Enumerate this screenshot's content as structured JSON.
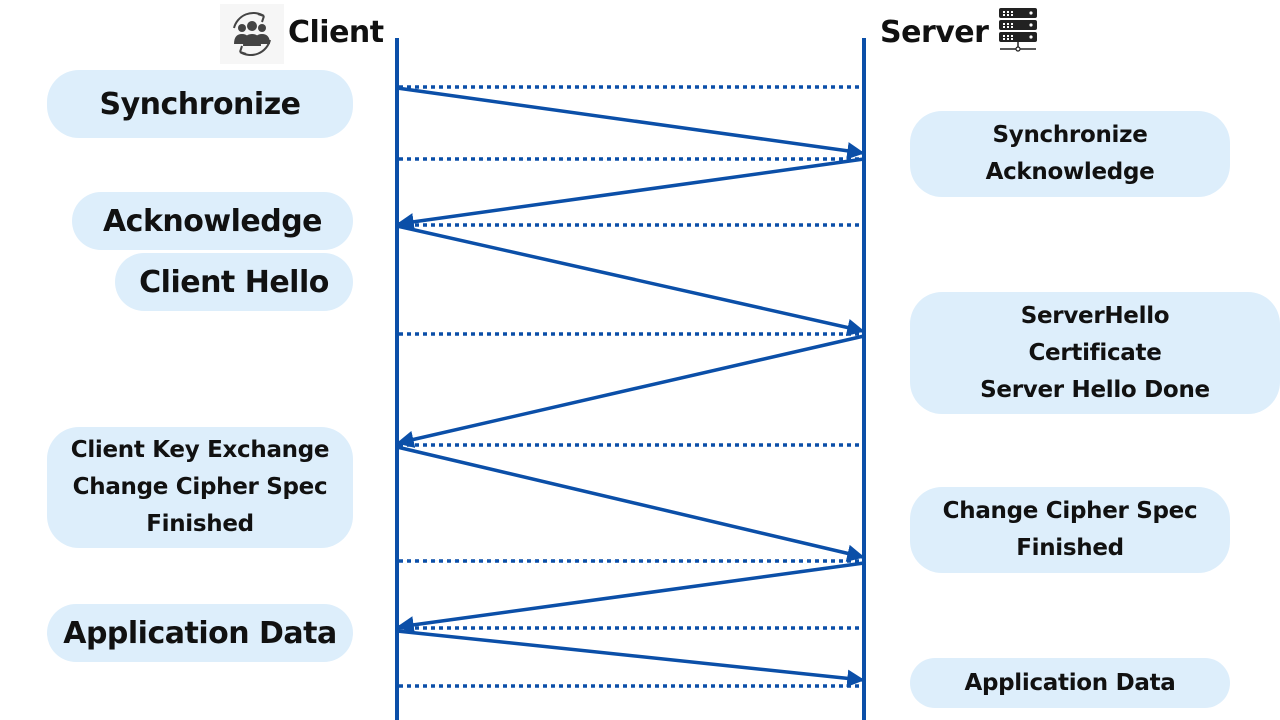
{
  "participants": {
    "client": {
      "label": "Client",
      "icon": "client-sync-group-icon"
    },
    "server": {
      "label": "Server",
      "icon": "server-rack-icon"
    }
  },
  "colors": {
    "line": "#0b4fa8",
    "pill_bg": "#ddeefb",
    "text": "#111111"
  },
  "client_labels": [
    {
      "lines": [
        "Synchronize"
      ]
    },
    {
      "lines": [
        "Acknowledge"
      ]
    },
    {
      "lines": [
        "Client Hello"
      ]
    },
    {
      "lines": [
        "Client Key Exchange",
        "Change Cipher Spec",
        "Finished"
      ]
    },
    {
      "lines": [
        "Application Data"
      ]
    }
  ],
  "server_labels": [
    {
      "lines": [
        "Synchronize",
        "Acknowledge"
      ]
    },
    {
      "lines": [
        "ServerHello",
        "Certificate",
        "Server Hello Done"
      ]
    },
    {
      "lines": [
        "Change Cipher Spec",
        "Finished"
      ]
    },
    {
      "lines": [
        "Application Data"
      ]
    }
  ],
  "messages": [
    {
      "from": "client",
      "to": "server",
      "label": "Synchronize"
    },
    {
      "from": "server",
      "to": "client",
      "label": "Synchronize Acknowledge"
    },
    {
      "from": "client",
      "to": "server",
      "label": "Acknowledge / Client Hello"
    },
    {
      "from": "server",
      "to": "client",
      "label": "ServerHello / Certificate / Server Hello Done"
    },
    {
      "from": "client",
      "to": "server",
      "label": "Client Key Exchange / Change Cipher Spec / Finished"
    },
    {
      "from": "server",
      "to": "client",
      "label": "Change Cipher Spec / Finished"
    },
    {
      "from": "client",
      "to": "server",
      "label": "Application Data"
    }
  ]
}
